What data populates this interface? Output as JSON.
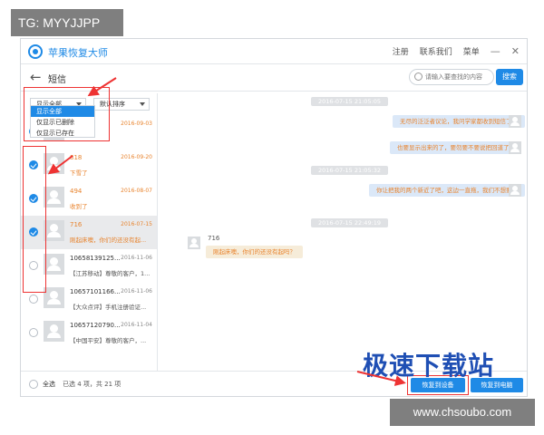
{
  "overlay": {
    "tg_label": "TG: MYYJJPP"
  },
  "app": {
    "title": "苹果恢复大师",
    "menu": [
      "注册",
      "联系我们",
      "菜单"
    ],
    "minimize": "—",
    "close": "✕"
  },
  "toolbar": {
    "back": "←",
    "page_title": "短信",
    "search_placeholder": "请输入要查找的内容",
    "search_label": "搜索"
  },
  "filter": {
    "selected": "显示全部",
    "options": [
      "显示全部",
      "仅显示已删除",
      "仅显示已存在"
    ],
    "sort_label": "默认排序"
  },
  "conversations": [
    {
      "name": "",
      "date": "2016-09-03",
      "preview": "",
      "checked": true,
      "orange": true,
      "active": false
    },
    {
      "name": "818",
      "date": "2016-09-20",
      "preview": "下雪了",
      "checked": true,
      "orange": true,
      "active": false
    },
    {
      "name": "494",
      "date": "2016-08-07",
      "preview": "收到了",
      "checked": true,
      "orange": true,
      "active": false
    },
    {
      "name": "716",
      "date": "2016-07-15",
      "preview": "刚起床噢，你们的还没有起...",
      "checked": true,
      "orange": true,
      "active": true
    },
    {
      "name": "10658139125...",
      "date": "2016-11-06",
      "preview": "【江苏移动】尊敬的客户，1...",
      "checked": false,
      "orange": false,
      "active": false
    },
    {
      "name": "10657101166...",
      "date": "2016-11-06",
      "preview": "【大众点评】手机注册验证...",
      "checked": false,
      "orange": false,
      "active": false
    },
    {
      "name": "10657120790...",
      "date": "2016-11-04",
      "preview": "【中国平安】尊敬的客户，...",
      "checked": false,
      "orange": false,
      "active": false
    }
  ],
  "chat": {
    "timestamps": [
      "2016-07-15 21:05:05",
      "2016-07-15 21:05:32",
      "2016-07-15 22:49:19"
    ],
    "sent": [
      "无尽的泛泛者议论，我问学家都收到短信了？",
      "也要显示出来的了，要勿要不要说把回道了",
      "你让把我的两个新近了吧，这边一直拖，我们不想要了"
    ],
    "sender": "716",
    "received": "刚起床噢，你们的还没有起吗？"
  },
  "footer": {
    "select_all": "全选",
    "selected_count": "已选 4 项，共 21 项",
    "restore_device": "恢复到设备",
    "restore_pc": "恢复到电脑"
  },
  "watermark": {
    "text": "极速下载站",
    "url": "www.chsoubo.com"
  },
  "colors": {
    "accent": "#1f8ae6",
    "highlight": "#e8832d",
    "annotation": "#ee3333"
  }
}
